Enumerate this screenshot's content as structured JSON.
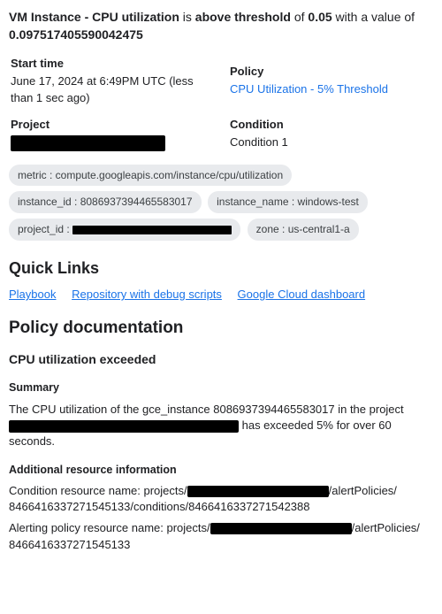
{
  "alert": {
    "prefix": "VM Instance - CPU utilization",
    "mid1": " is ",
    "state": "above threshold",
    "mid2": " of ",
    "threshold": "0.05",
    "mid3": " with a value of ",
    "value": "0.097517405590042475"
  },
  "meta": {
    "start_label": "Start time",
    "start_val": "June 17, 2024 at 6:49PM UTC (less than 1 sec ago)",
    "policy_label": "Policy",
    "policy_link": "CPU Utilization - 5% Threshold",
    "project_label": "Project",
    "condition_label": "Condition",
    "condition_val": "Condition 1"
  },
  "chips": {
    "metric": "metric : compute.googleapis.com/instance/cpu/utilization",
    "instance_id": "instance_id : 8086937394465583017",
    "instance_name": "instance_name : windows-test",
    "project_id_prefix": "project_id : ",
    "zone": "zone : us-central1-a"
  },
  "quick": {
    "heading": "Quick Links",
    "playbook": "Playbook",
    "repo": "Repository with debug scripts",
    "dashboard": "Google Cloud dashboard"
  },
  "doc": {
    "heading": "Policy documentation",
    "sub": "CPU utilization exceeded",
    "summary_label": "Summary",
    "summary_pre": "The CPU utilization of the gce_instance 8086937394465583017 in the project ",
    "summary_post": " has exceeded 5% for over 60 seconds.",
    "addl_label": "Additional resource information",
    "cond_pre": "Condition resource name: projects/",
    "cond_mid": "/alertPolicies/",
    "cond_suffix": "8466416337271545133/conditions/8466416337271542388",
    "policy_pre": "Alerting policy resource name: projects/",
    "policy_mid": "/alertPolicies/",
    "policy_suffix": "8466416337271545133"
  }
}
